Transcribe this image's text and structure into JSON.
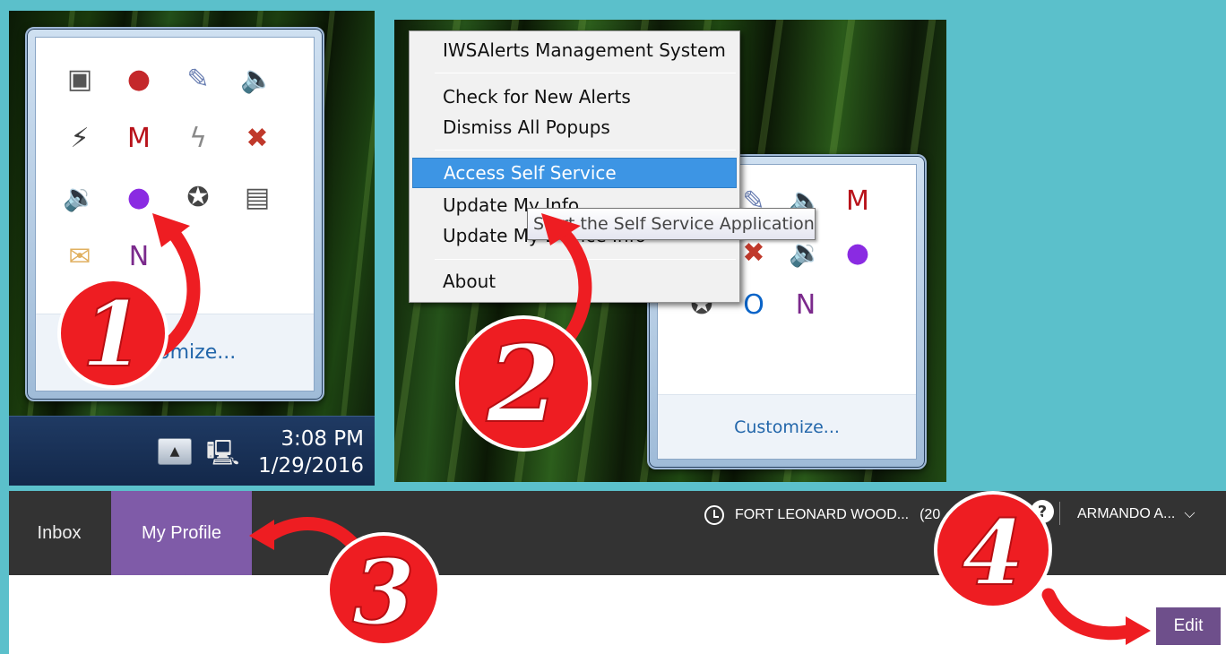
{
  "panel1": {
    "tray_icons": [
      {
        "name": "drive-icon",
        "glyph": "▣",
        "color": "#555555"
      },
      {
        "name": "swirl-app-icon",
        "glyph": "●",
        "color": "#c4282b"
      },
      {
        "name": "pen-tablet-icon",
        "glyph": "✎",
        "color": "#6a7fb2"
      },
      {
        "name": "speaker-icon",
        "glyph": "🔈",
        "color": "#c07020"
      },
      {
        "name": "power-plug-icon",
        "glyph": "⚡",
        "color": "#3d3d3d"
      },
      {
        "name": "mcafee-shield-icon",
        "glyph": "M",
        "color": "#b8121a"
      },
      {
        "name": "lightning-icon",
        "glyph": "ϟ",
        "color": "#8a8a8a"
      },
      {
        "name": "network-error-icon",
        "glyph": "✖",
        "color": "#c0392b"
      },
      {
        "name": "volume-icon",
        "glyph": "🔉",
        "color": "#7a7a7a"
      },
      {
        "name": "iwsalerts-globe-icon",
        "glyph": "●",
        "color": "#8a2be2"
      },
      {
        "name": "sync-error-icon",
        "glyph": "✪",
        "color": "#444444"
      },
      {
        "name": "action-center-icon",
        "glyph": "▤",
        "color": "#555555"
      },
      {
        "name": "mail-icon",
        "glyph": "✉",
        "color": "#e0b060"
      },
      {
        "name": "onenote-clip-icon",
        "glyph": "N",
        "color": "#7b2a8c"
      }
    ],
    "customize_label": "Customize...",
    "clock_time": "3:08 PM",
    "clock_date": "1/29/2016"
  },
  "panel2": {
    "menu_items": [
      "IWSAlerts Management System",
      "Check for New Alerts",
      "Dismiss All Popups",
      "Access Self Service",
      "Update My Info",
      "Update My Device Info",
      "About"
    ],
    "tooltip": "Start the Self Service Application",
    "customize_label": "Customize...",
    "tray_icons": [
      {
        "name": "swirl-app-icon",
        "glyph": "●",
        "color": "#c4282b"
      },
      {
        "name": "pen-tablet-icon",
        "glyph": "✎",
        "color": "#6a7fb2"
      },
      {
        "name": "speaker-icon",
        "glyph": "🔈",
        "color": "#c07020"
      },
      {
        "name": "mcafee-shield-icon",
        "glyph": "M",
        "color": "#b8121a"
      },
      {
        "name": "lightning-icon",
        "glyph": "ϟ",
        "color": "#8a8a8a"
      },
      {
        "name": "network-error-icon",
        "glyph": "✖",
        "color": "#c0392b"
      },
      {
        "name": "volume-icon",
        "glyph": "🔉",
        "color": "#7a7a7a"
      },
      {
        "name": "iwsalerts-globe-icon",
        "glyph": "●",
        "color": "#8a2be2"
      },
      {
        "name": "sync-error-icon",
        "glyph": "✪",
        "color": "#444444"
      },
      {
        "name": "outlook-icon",
        "glyph": "O",
        "color": "#0a64c8"
      },
      {
        "name": "onenote-clip-icon",
        "glyph": "N",
        "color": "#7b2a8c"
      }
    ]
  },
  "appbar": {
    "tab_inbox": "Inbox",
    "tab_profile": "My Profile",
    "org_label": "FORT LEONARD WOOD...",
    "org_count": "(20",
    "user_label": "ARMANDO A...",
    "edit_label": "Edit",
    "accent": "#7f5ba8"
  },
  "steps": [
    "1",
    "2",
    "3",
    "4"
  ]
}
